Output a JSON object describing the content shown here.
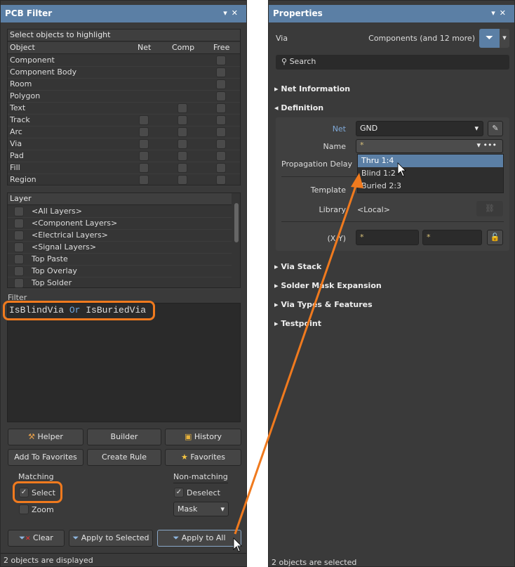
{
  "filter_panel": {
    "title": "PCB Filter",
    "objects_header": "Select objects to highlight",
    "columns": [
      "Object",
      "Net",
      "Comp",
      "Free"
    ],
    "objects": [
      {
        "name": "Component",
        "net": false,
        "comp": false,
        "free": true
      },
      {
        "name": "Component Body",
        "net": false,
        "comp": false,
        "free": true
      },
      {
        "name": "Room",
        "net": false,
        "comp": false,
        "free": true
      },
      {
        "name": "Polygon",
        "net": false,
        "comp": false,
        "free": true
      },
      {
        "name": "Text",
        "net": false,
        "comp": true,
        "free": true
      },
      {
        "name": "Track",
        "net": true,
        "comp": true,
        "free": true
      },
      {
        "name": "Arc",
        "net": true,
        "comp": true,
        "free": true
      },
      {
        "name": "Via",
        "net": true,
        "comp": true,
        "free": true
      },
      {
        "name": "Pad",
        "net": true,
        "comp": true,
        "free": true
      },
      {
        "name": "Fill",
        "net": true,
        "comp": true,
        "free": true
      },
      {
        "name": "Region",
        "net": true,
        "comp": true,
        "free": true
      }
    ],
    "layer_header": "Layer",
    "layers": [
      "<All Layers>",
      "<Component Layers>",
      "<Electrical Layers>",
      "<Signal Layers>",
      "Top Paste",
      "Top Overlay",
      "Top Solder"
    ],
    "filter_label": "Filter",
    "query": {
      "part1": "IsBlindVia",
      "op": "Or",
      "part2": "IsBuriedVia"
    },
    "buttons": {
      "helper": "Helper",
      "builder": "Builder",
      "history": "History",
      "add_fav": "Add To Favorites",
      "create_rule": "Create Rule",
      "favorites": "Favorites",
      "clear": "Clear",
      "apply_selected": "Apply to Selected",
      "apply_all": "Apply to All"
    },
    "matching": {
      "label": "Matching",
      "select": "Select",
      "zoom": "Zoom"
    },
    "non_matching": {
      "label": "Non-matching",
      "deselect": "Deselect",
      "mode": "Mask"
    },
    "status": "2 objects are displayed"
  },
  "properties_panel": {
    "title": "Properties",
    "object": "Via",
    "filter_text": "Components (and 12 more)",
    "search_placeholder": "Search",
    "sections": [
      "Net Information",
      "Definition",
      "Via Stack",
      "Solder Mask Expansion",
      "Via Types & Features",
      "Testpoint"
    ],
    "net_label": "Net",
    "net_value": "GND",
    "name_label": "Name",
    "name_value": "*",
    "prop_delay_label": "Propagation Delay",
    "template_label": "Template",
    "library_label": "Library",
    "library_value": "<Local>",
    "xy_label": "(X/Y)",
    "x_value": "*",
    "y_value": "*",
    "dropdown_options": [
      "Thru 1:4",
      "Blind 1:2",
      "Buried 2:3"
    ],
    "status": "2 objects are selected"
  },
  "colors": {
    "accent": "#5b7fa5",
    "highlight": "#f07a1e"
  }
}
